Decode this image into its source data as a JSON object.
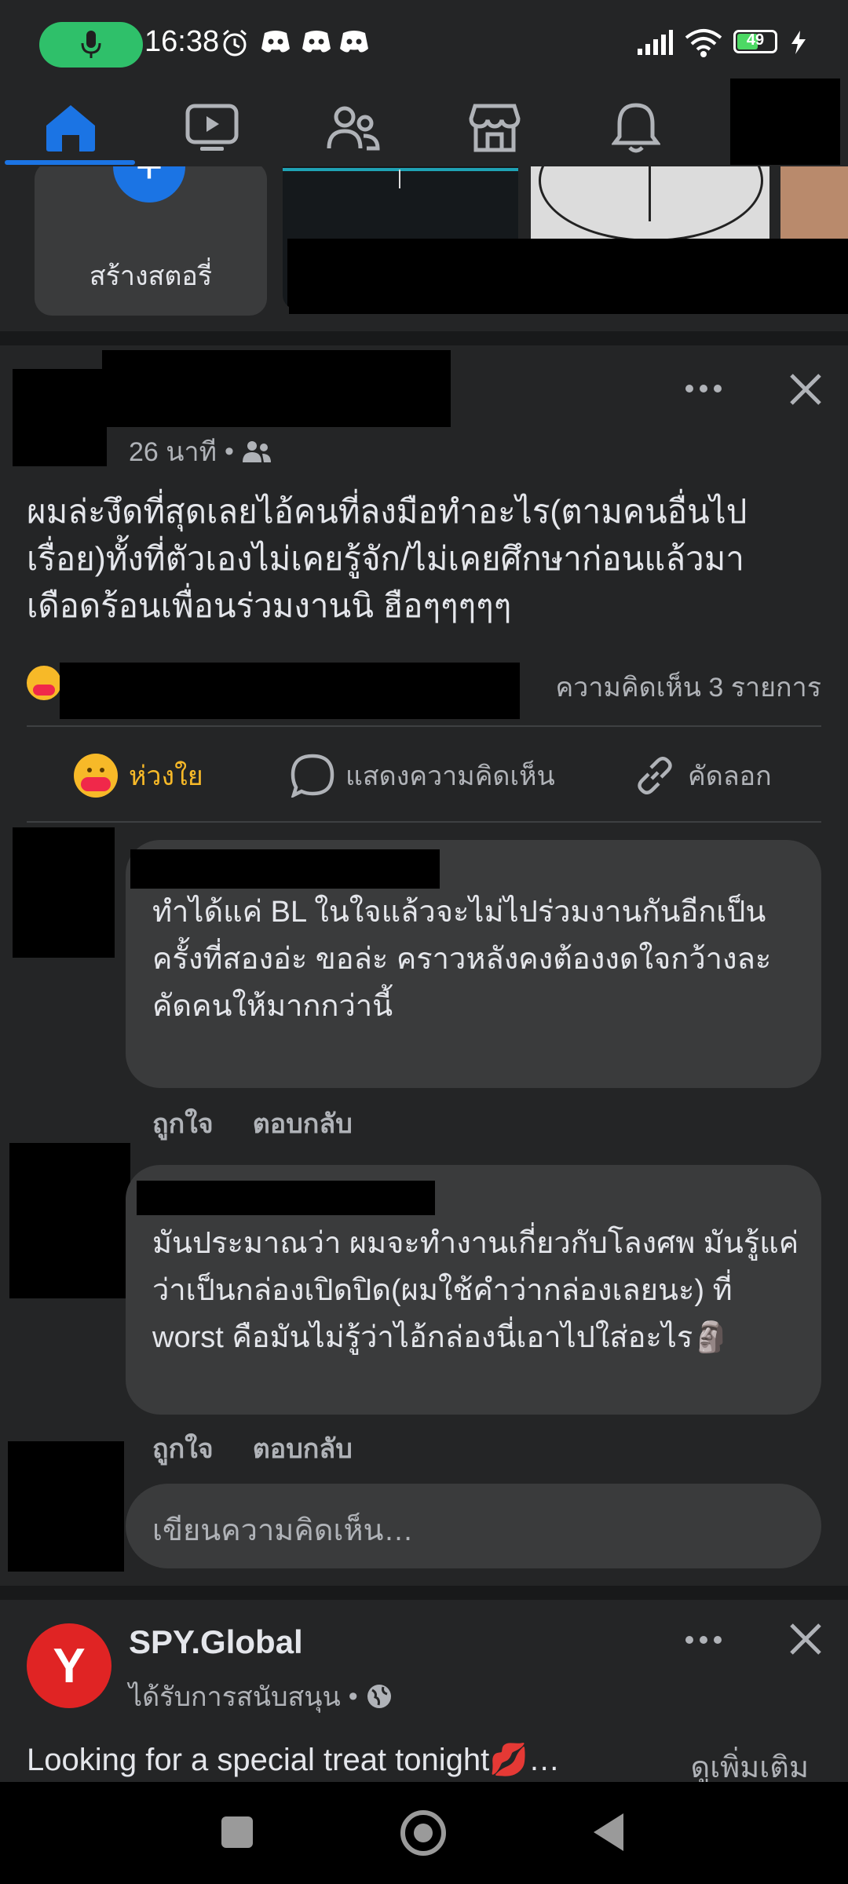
{
  "status_bar": {
    "time": "16:38",
    "battery": "49",
    "icons": [
      "mic-icon",
      "alarm-icon",
      "discord-icon",
      "discord-icon",
      "discord-icon",
      "signal-icon",
      "wifi-icon",
      "battery-icon",
      "charging-icon"
    ]
  },
  "nav": {
    "tabs": [
      "home-icon",
      "video-icon",
      "friends-icon",
      "marketplace-icon",
      "notifications-icon",
      "menu-avatar"
    ],
    "active": "home"
  },
  "stories": {
    "create_label": "สร้างสตอรี่"
  },
  "post": {
    "time": "26 นาที",
    "audience_icon": "friends-icon",
    "body": "ผมล่ะงึดที่สุดเลยไอ้คนที่ลงมือทำอะไร(ตามคนอื่นไปเรื่อย)ทั้งที่ตัวเองไม่เคยรู้จัก/ไม่เคยศึกษาก่อนแล้วมาเดือดร้อนเพื่อนร่วมงานนิ ฮือๆๆๆๆๆ",
    "comment_count": "ความคิดเห็น 3 รายการ",
    "actions": {
      "care": "ห่วงใย",
      "comment": "แสดงความคิดเห็น",
      "copy": "คัดลอก"
    }
  },
  "comments": [
    {
      "text": "ทำได้แค่ BL ในใจแล้วจะไม่ไปร่วมงานกันอีกเป็นครั้งที่สองอ่ะ ขอล่ะ คราวหลังคงต้องงดใจกว้างละคัดคนให้มากกว่านี้",
      "like": "ถูกใจ",
      "reply": "ตอบกลับ"
    },
    {
      "text": "มันประมาณว่า ผมจะทำงานเกี่ยวกับโลงศพ มันรู้แค่ว่าเป็นกล่องเปิดปิด(ผมใช้คำว่ากล่องเลยนะ) ที่ worst คือมันไม่รู้ว่าไอ้กล่องนี่เอาไปใส่อะไร🗿",
      "like": "ถูกใจ",
      "reply": "ตอบกลับ"
    }
  ],
  "write_comment": {
    "placeholder": "เขียนความคิดเห็น…"
  },
  "sponsored": {
    "name": "SPY.Global",
    "sub": "ได้รับการสนับสนุน",
    "text": "Looking for a special treat tonight💋…",
    "see_more": "ดูเพิ่มเติม",
    "logo_letter": "Y"
  },
  "colors": {
    "background": "#242526",
    "accent": "#1b74e4",
    "care": "#f7b928",
    "mic": "#2fc06a",
    "spy_red": "#e02424"
  }
}
